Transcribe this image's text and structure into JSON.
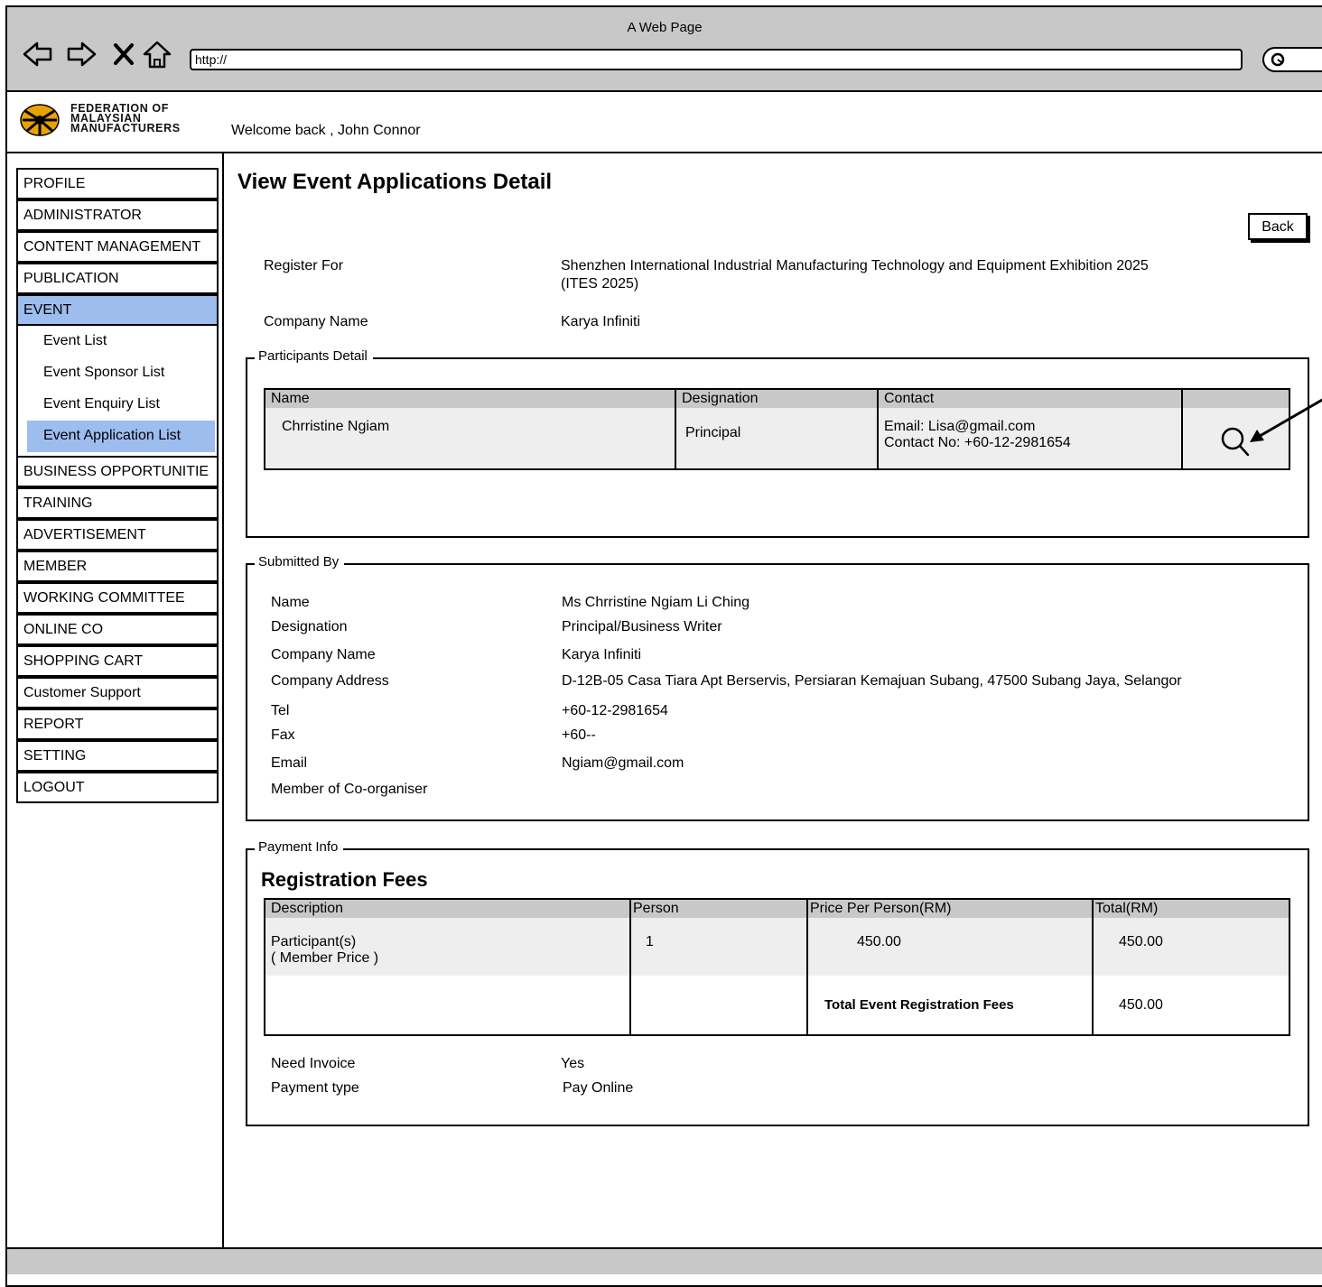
{
  "browser": {
    "title": "A Web Page",
    "url": "http://"
  },
  "header": {
    "logo_lines": [
      "FEDERATION OF",
      "MALAYSIAN",
      "MANUFACTURERS"
    ],
    "welcome": "Welcome back , John Connor"
  },
  "sidebar": {
    "items": [
      {
        "label": "PROFILE"
      },
      {
        "label": "ADMINISTRATOR"
      },
      {
        "label": "CONTENT MANAGEMENT"
      },
      {
        "label": "PUBLICATION"
      },
      {
        "label": "EVENT",
        "active": true
      }
    ],
    "event_sub": [
      {
        "label": "Event List"
      },
      {
        "label": "Event Sponsor List"
      },
      {
        "label": "Event Enquiry List"
      },
      {
        "label": "Event Application List",
        "active": true
      }
    ],
    "items_after": [
      {
        "label": "BUSINESS OPPORTUNITIE"
      },
      {
        "label": "TRAINING"
      },
      {
        "label": "ADVERTISEMENT"
      },
      {
        "label": "MEMBER"
      },
      {
        "label": "WORKING COMMITTEE"
      },
      {
        "label": "ONLINE CO"
      },
      {
        "label": "SHOPPING CART"
      },
      {
        "label": "Customer Support"
      },
      {
        "label": "REPORT"
      },
      {
        "label": "SETTING"
      },
      {
        "label": "LOGOUT"
      }
    ]
  },
  "main": {
    "title": "View Event Applications Detail",
    "back_label": "Back",
    "register_for_label": "Register For",
    "register_for_value_1": "Shenzhen International Industrial Manufacturing Technology and Equipment Exhibition 2025",
    "register_for_value_2": "(ITES 2025)",
    "company_name_label": "Company Name",
    "company_name_value": "Karya Infiniti"
  },
  "participants": {
    "legend": "Participants Detail",
    "headers": [
      "Name",
      "Designation",
      "Contact",
      ""
    ],
    "rows": [
      {
        "name": "Chrristine Ngiam",
        "designation": "Principal",
        "email": "Email: Lisa@gmail.com",
        "contact": "Contact No: +60-12-2981654"
      }
    ]
  },
  "submitted_by": {
    "legend": "Submitted By",
    "fields": [
      {
        "label": "Name",
        "value": "Ms Chrristine Ngiam Li Ching"
      },
      {
        "label": "Designation",
        "value": "Principal/Business Writer"
      },
      {
        "label": "Company Name",
        "value": "Karya Infiniti"
      },
      {
        "label": "Company Address",
        "value": "D-12B-05 Casa Tiara Apt Berservis, Persiaran Kemajuan Subang, 47500 Subang Jaya, Selangor"
      },
      {
        "label": "Tel",
        "value": "+60-12-2981654"
      },
      {
        "label": "Fax",
        "value": "+60--"
      },
      {
        "label": "Email",
        "value": "Ngiam@gmail.com"
      },
      {
        "label": "Member of Co-organiser",
        "value": ""
      }
    ]
  },
  "payment": {
    "legend": "Payment Info",
    "reg_title": "Registration Fees",
    "headers": [
      "Description",
      "Person",
      "Price Per Person(RM)",
      "Total(RM)"
    ],
    "row_desc_1": "Participant(s)",
    "row_desc_2": "( Member Price )",
    "row_person": "1",
    "row_price": "450.00",
    "row_total": "450.00",
    "total_label": "Total Event Registration Fees",
    "total_value": "450.00",
    "need_invoice_label": "Need Invoice",
    "need_invoice_value": "Yes",
    "payment_type_label": "Payment type",
    "payment_type_value": "Pay Online"
  },
  "colors": {
    "chrome": "#c8c8c8",
    "active": "#9dbdef",
    "row_bg": "#eeeeee"
  }
}
